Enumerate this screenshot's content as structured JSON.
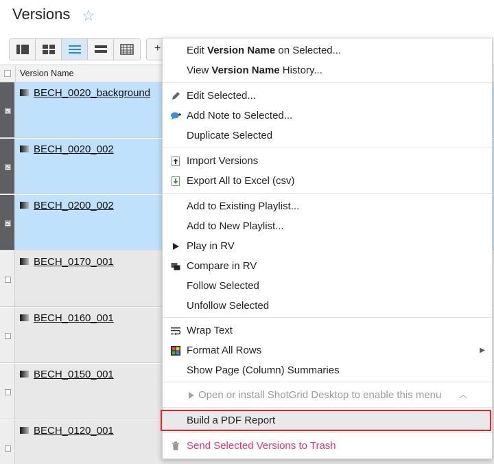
{
  "page": {
    "title": "Versions"
  },
  "grid": {
    "header_label": "Version Name"
  },
  "rows": [
    {
      "name": "BECH_0020_background",
      "selected": true
    },
    {
      "name": "BECH_0020_002",
      "selected": true
    },
    {
      "name": "BECH_0200_002",
      "selected": true
    },
    {
      "name": "BECH_0170_001",
      "selected": false
    },
    {
      "name": "BECH_0160_001",
      "selected": false
    },
    {
      "name": "BECH_0150_001",
      "selected": false
    },
    {
      "name": "BECH_0120_001",
      "selected": false
    }
  ],
  "menu": {
    "edit_field_prefix": "Edit ",
    "edit_field_bold": "Version Name",
    "edit_field_suffix": " on Selected...",
    "view_history_prefix": "View ",
    "view_history_bold": "Version Name",
    "view_history_suffix": " History...",
    "edit_selected": "Edit Selected...",
    "add_note": "Add Note to Selected...",
    "duplicate": "Duplicate Selected",
    "import_versions": "Import Versions",
    "export_excel": "Export All to Excel (csv)",
    "add_existing_playlist": "Add to Existing Playlist...",
    "add_new_playlist": "Add to New Playlist...",
    "play_rv": "Play in RV",
    "compare_rv": "Compare in RV",
    "follow": "Follow Selected",
    "unfollow": "Unfollow Selected",
    "wrap_text": "Wrap Text",
    "format_rows": "Format All Rows",
    "page_summaries": "Show Page (Column) Summaries",
    "shotgrid_desktop": "Open or install ShotGrid Desktop to enable this menu",
    "pdf_report": "Build a PDF Report",
    "trash": "Send Selected Versions to Trash"
  },
  "icons": {
    "pencil": "pencil-icon",
    "note": "note-bubble-icon",
    "import": "import-icon",
    "export": "export-icon",
    "play": "play-icon",
    "compare": "compare-icon",
    "wrap": "wrap-text-icon",
    "format": "format-grid-icon",
    "trash": "trash-icon"
  },
  "colors": {
    "selected_row": "#bfe1fb",
    "danger_text": "#e8336b",
    "highlight_border": "#e8232a",
    "star": "#7bb6e8"
  }
}
